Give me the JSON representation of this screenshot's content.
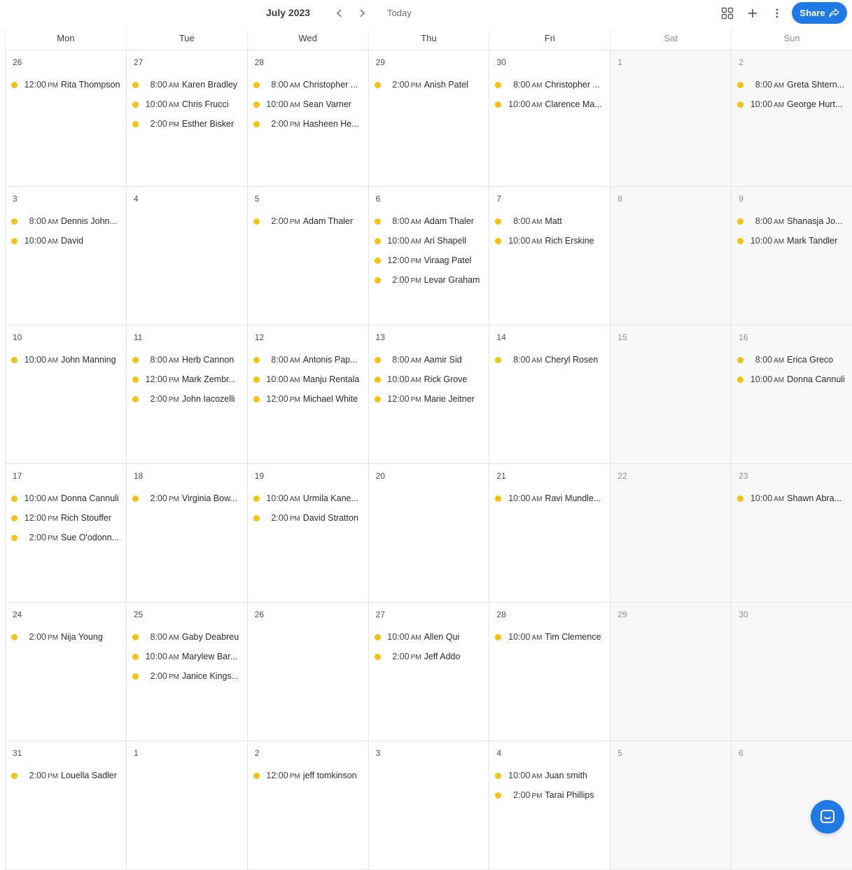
{
  "header": {
    "month_title": "July 2023",
    "today_label": "Today",
    "share_label": "Share",
    "prev_icon": "chevron-left-icon",
    "next_icon": "chevron-right-icon",
    "view_icon": "grid-view-icon",
    "add_icon": "plus-icon",
    "more_icon": "more-vertical-icon"
  },
  "colors": {
    "accent": "#1f7ae6",
    "event_dot": "#f5c211",
    "weekend_bg": "#f8f8f8"
  },
  "day_names": [
    "Mon",
    "Tue",
    "Wed",
    "Thu",
    "Fri",
    "Sat",
    "Sun"
  ],
  "weeks": [
    [
      {
        "day": "26",
        "events": [
          {
            "time": "12:00",
            "ampm": "PM",
            "name": "Rita Thompson"
          }
        ]
      },
      {
        "day": "27",
        "events": [
          {
            "time": "8:00",
            "ampm": "AM",
            "name": "Karen Bradley"
          },
          {
            "time": "10:00",
            "ampm": "AM",
            "name": "Chris Frucci"
          },
          {
            "time": "2:00",
            "ampm": "PM",
            "name": "Esther Bisker"
          }
        ]
      },
      {
        "day": "28",
        "events": [
          {
            "time": "8:00",
            "ampm": "AM",
            "name": "Christopher ..."
          },
          {
            "time": "10:00",
            "ampm": "AM",
            "name": "Sean Varner"
          },
          {
            "time": "2:00",
            "ampm": "PM",
            "name": "Hasheen He..."
          }
        ]
      },
      {
        "day": "29",
        "events": [
          {
            "time": "2:00",
            "ampm": "PM",
            "name": "Anish Patel"
          }
        ]
      },
      {
        "day": "30",
        "events": [
          {
            "time": "8:00",
            "ampm": "AM",
            "name": "Christopher ..."
          },
          {
            "time": "10:00",
            "ampm": "AM",
            "name": "Clarence Ma..."
          }
        ]
      },
      {
        "day": "1",
        "events": []
      },
      {
        "day": "2",
        "events": [
          {
            "time": "8:00",
            "ampm": "AM",
            "name": "Greta Shtern..."
          },
          {
            "time": "10:00",
            "ampm": "AM",
            "name": "George Hurt..."
          }
        ]
      }
    ],
    [
      {
        "day": "3",
        "events": [
          {
            "time": "8:00",
            "ampm": "AM",
            "name": "Dennis John..."
          },
          {
            "time": "10:00",
            "ampm": "AM",
            "name": "David"
          }
        ]
      },
      {
        "day": "4",
        "events": []
      },
      {
        "day": "5",
        "events": [
          {
            "time": "2:00",
            "ampm": "PM",
            "name": "Adam Thaler"
          }
        ]
      },
      {
        "day": "6",
        "events": [
          {
            "time": "8:00",
            "ampm": "AM",
            "name": "Adam Thaler"
          },
          {
            "time": "10:00",
            "ampm": "AM",
            "name": "Ari Shapell"
          },
          {
            "time": "12:00",
            "ampm": "PM",
            "name": "Viraag Patel"
          },
          {
            "time": "2:00",
            "ampm": "PM",
            "name": "Levar Graham"
          }
        ]
      },
      {
        "day": "7",
        "events": [
          {
            "time": "8:00",
            "ampm": "AM",
            "name": "Matt"
          },
          {
            "time": "10:00",
            "ampm": "AM",
            "name": "Rich Erskine"
          }
        ]
      },
      {
        "day": "8",
        "events": []
      },
      {
        "day": "9",
        "events": [
          {
            "time": "8:00",
            "ampm": "AM",
            "name": "Shanasja Jo..."
          },
          {
            "time": "10:00",
            "ampm": "AM",
            "name": "Mark Tandler"
          }
        ]
      }
    ],
    [
      {
        "day": "10",
        "events": [
          {
            "time": "10:00",
            "ampm": "AM",
            "name": "John Manning"
          }
        ]
      },
      {
        "day": "11",
        "events": [
          {
            "time": "8:00",
            "ampm": "AM",
            "name": "Herb Cannon"
          },
          {
            "time": "12:00",
            "ampm": "PM",
            "name": "Mark Zembr..."
          },
          {
            "time": "2:00",
            "ampm": "PM",
            "name": "John Iacozelli"
          }
        ]
      },
      {
        "day": "12",
        "events": [
          {
            "time": "8:00",
            "ampm": "AM",
            "name": "Antonis Pap..."
          },
          {
            "time": "10:00",
            "ampm": "AM",
            "name": "Manju Rentala"
          },
          {
            "time": "12:00",
            "ampm": "PM",
            "name": "Michael White"
          }
        ]
      },
      {
        "day": "13",
        "events": [
          {
            "time": "8:00",
            "ampm": "AM",
            "name": "Aamir Sid"
          },
          {
            "time": "10:00",
            "ampm": "AM",
            "name": "Rick Grove"
          },
          {
            "time": "12:00",
            "ampm": "PM",
            "name": "Marie Jeitner"
          }
        ]
      },
      {
        "day": "14",
        "events": [
          {
            "time": "8:00",
            "ampm": "AM",
            "name": "Cheryl Rosen"
          }
        ]
      },
      {
        "day": "15",
        "events": []
      },
      {
        "day": "16",
        "events": [
          {
            "time": "8:00",
            "ampm": "AM",
            "name": "Erica Greco"
          },
          {
            "time": "10:00",
            "ampm": "AM",
            "name": "Donna Cannuli"
          }
        ]
      }
    ],
    [
      {
        "day": "17",
        "events": [
          {
            "time": "10:00",
            "ampm": "AM",
            "name": "Donna Cannuli"
          },
          {
            "time": "12:00",
            "ampm": "PM",
            "name": "Rich Stouffer"
          },
          {
            "time": "2:00",
            "ampm": "PM",
            "name": "Sue O'odonn..."
          }
        ]
      },
      {
        "day": "18",
        "events": [
          {
            "time": "2:00",
            "ampm": "PM",
            "name": "Virginia Bow..."
          }
        ]
      },
      {
        "day": "19",
        "events": [
          {
            "time": "10:00",
            "ampm": "AM",
            "name": "Urmila Kane..."
          },
          {
            "time": "2:00",
            "ampm": "PM",
            "name": "David Stratton"
          }
        ]
      },
      {
        "day": "20",
        "events": []
      },
      {
        "day": "21",
        "events": [
          {
            "time": "10:00",
            "ampm": "AM",
            "name": "Ravi Mundle..."
          }
        ]
      },
      {
        "day": "22",
        "events": []
      },
      {
        "day": "23",
        "events": [
          {
            "time": "10:00",
            "ampm": "AM",
            "name": "Shawn Abra..."
          }
        ]
      }
    ],
    [
      {
        "day": "24",
        "events": [
          {
            "time": "2:00",
            "ampm": "PM",
            "name": "Nija Young"
          }
        ]
      },
      {
        "day": "25",
        "events": [
          {
            "time": "8:00",
            "ampm": "AM",
            "name": "Gaby Deabreu"
          },
          {
            "time": "10:00",
            "ampm": "AM",
            "name": "Marylew Bar..."
          },
          {
            "time": "2:00",
            "ampm": "PM",
            "name": "Janice Kings..."
          }
        ]
      },
      {
        "day": "26",
        "events": []
      },
      {
        "day": "27",
        "events": [
          {
            "time": "10:00",
            "ampm": "AM",
            "name": "Allen Qui"
          },
          {
            "time": "2:00",
            "ampm": "PM",
            "name": "Jeff Addo"
          }
        ]
      },
      {
        "day": "28",
        "events": [
          {
            "time": "10:00",
            "ampm": "AM",
            "name": "Tim Clemence"
          }
        ]
      },
      {
        "day": "29",
        "events": []
      },
      {
        "day": "30",
        "events": []
      }
    ],
    [
      {
        "day": "31",
        "events": [
          {
            "time": "2:00",
            "ampm": "PM",
            "name": "Louella Sadler"
          }
        ]
      },
      {
        "day": "1",
        "events": []
      },
      {
        "day": "2",
        "events": [
          {
            "time": "12:00",
            "ampm": "PM",
            "name": "jeff tomkinson"
          }
        ]
      },
      {
        "day": "3",
        "events": []
      },
      {
        "day": "4",
        "events": [
          {
            "time": "10:00",
            "ampm": "AM",
            "name": "Juan smith"
          },
          {
            "time": "2:00",
            "ampm": "PM",
            "name": "Tarai Phillips"
          }
        ]
      },
      {
        "day": "5",
        "events": []
      },
      {
        "day": "6",
        "events": []
      }
    ]
  ],
  "chat": {
    "icon": "chat-bubble-icon"
  }
}
